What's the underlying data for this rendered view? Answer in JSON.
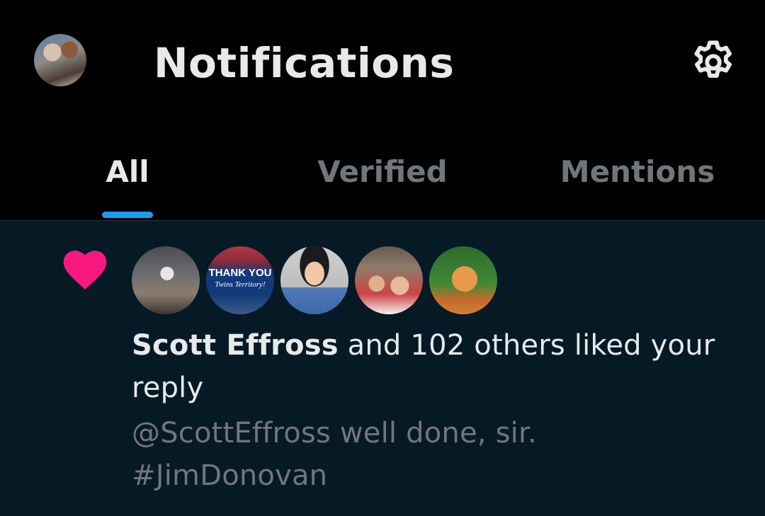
{
  "header": {
    "title": "Notifications",
    "settings_icon": "gear-icon"
  },
  "tabs": [
    {
      "label": "All",
      "active": true
    },
    {
      "label": "Verified",
      "active": false
    },
    {
      "label": "Mentions",
      "active": false
    }
  ],
  "colors": {
    "accent": "#1d9bf0",
    "like": "#f91880",
    "background": "#000000",
    "notification_bg": "#061a26",
    "text_primary": "#e7e9ea",
    "text_secondary": "#71767b"
  },
  "notification": {
    "type_icon": "heart-icon",
    "avatar_count": 5,
    "avatar_thank_you_line1": "THANK YOU",
    "avatar_thank_you_line2": "Twins Territory!",
    "actor_name": "Scott Effross",
    "action_text": " and 102 others liked your reply",
    "excerpt_line1": "@ScottEffross well done, sir.",
    "excerpt_line2": "#JimDonovan"
  }
}
